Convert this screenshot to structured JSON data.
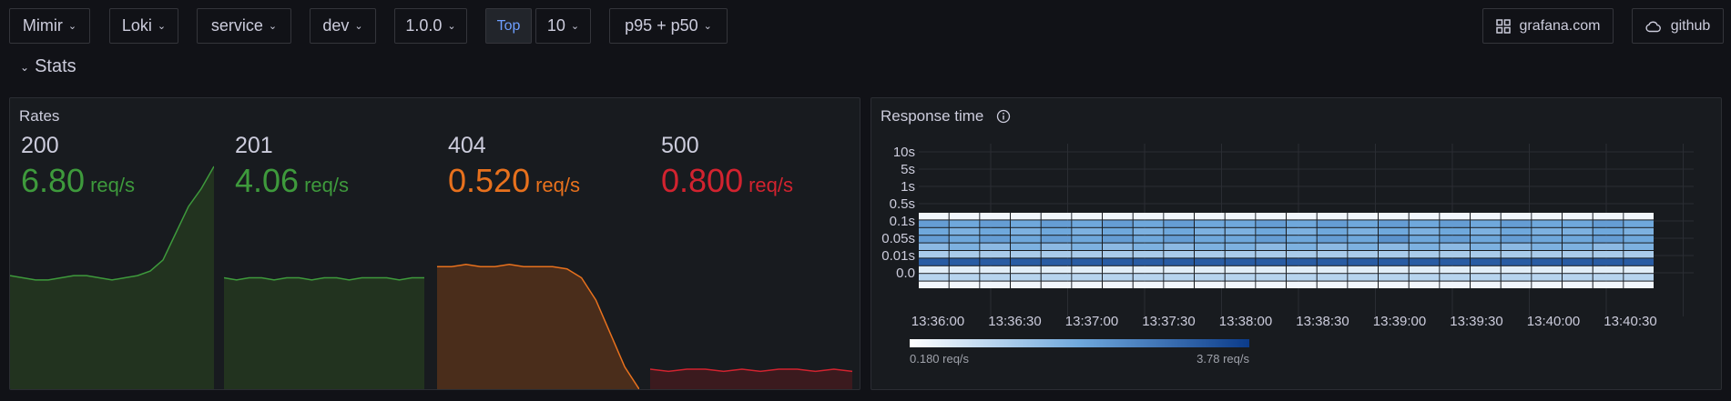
{
  "variables": [
    {
      "label": "Mimir"
    },
    {
      "label": "Loki"
    },
    {
      "label": "service"
    },
    {
      "label": "dev"
    },
    {
      "label": "1.0.0"
    }
  ],
  "top": {
    "label": "Top",
    "value": "10"
  },
  "percentile": {
    "label": "p95 + p50"
  },
  "links": {
    "grafana": "grafana.com",
    "github": "github"
  },
  "row": {
    "title": "Stats"
  },
  "rates": {
    "title": "Rates",
    "stats": [
      {
        "label": "200",
        "value": "6.80",
        "unit": "req/s",
        "color": "#3e9a3c",
        "fill": "#22331f",
        "spark": [
          0.49,
          0.5,
          0.51,
          0.51,
          0.5,
          0.49,
          0.49,
          0.5,
          0.51,
          0.5,
          0.49,
          0.47,
          0.42,
          0.3,
          0.18,
          0.1,
          0.0
        ]
      },
      {
        "label": "201",
        "value": "4.06",
        "unit": "req/s",
        "color": "#3e9a3c",
        "fill": "#22331f",
        "spark": [
          0.5,
          0.51,
          0.5,
          0.5,
          0.51,
          0.5,
          0.5,
          0.51,
          0.5,
          0.5,
          0.51,
          0.5,
          0.5,
          0.5,
          0.51,
          0.5,
          0.5
        ]
      },
      {
        "label": "404",
        "value": "0.520",
        "unit": "req/s",
        "color": "#e8711d",
        "fill": "#4a2d1b",
        "spark": [
          0.45,
          0.45,
          0.44,
          0.45,
          0.45,
          0.44,
          0.45,
          0.45,
          0.45,
          0.46,
          0.5,
          0.6,
          0.75,
          0.9,
          1.0
        ]
      },
      {
        "label": "500",
        "value": "0.800",
        "unit": "req/s",
        "color": "#d2232f",
        "fill": "#3b1a1e",
        "spark": [
          0.91,
          0.92,
          0.91,
          0.91,
          0.92,
          0.91,
          0.92,
          0.91,
          0.91,
          0.92,
          0.91,
          0.92
        ]
      }
    ]
  },
  "response_time": {
    "title": "Response time",
    "info_icon": "info-circle-icon",
    "legend": {
      "min": "0.180 req/s",
      "max": "3.78 req/s"
    }
  },
  "chart_data": {
    "type": "heatmap",
    "title": "Response time",
    "y_buckets": [
      "0.0",
      "0.01s",
      "0.05s",
      "0.1s",
      "0.5s",
      "1s",
      "5s",
      "10s"
    ],
    "x_ticks": [
      "13:36:00",
      "13:36:30",
      "13:37:00",
      "13:37:30",
      "13:38:00",
      "13:38:30",
      "13:39:00",
      "13:39:30",
      "13:40:00",
      "13:40:30"
    ],
    "legend_range": [
      "0.180 req/s",
      "3.78 req/s"
    ],
    "rows": [
      [
        0.05,
        0.05,
        0.05,
        0.05,
        0.05,
        0.05,
        0.05,
        0.05,
        0.05,
        0.05,
        0.05,
        0.05,
        0.05,
        0.05,
        0.05,
        0.05,
        0.05,
        0.05,
        0.05,
        0.05,
        0.05,
        0.05,
        0.05,
        0.05
      ],
      [
        0.55,
        0.5,
        0.55,
        0.5,
        0.55,
        0.5,
        0.55,
        0.5,
        0.55,
        0.5,
        0.5,
        0.55,
        0.5,
        0.55,
        0.5,
        0.55,
        0.5,
        0.55,
        0.5,
        0.55,
        0.5,
        0.5,
        0.55,
        0.5
      ],
      [
        0.5,
        0.45,
        0.5,
        0.45,
        0.5,
        0.45,
        0.5,
        0.45,
        0.5,
        0.45,
        0.45,
        0.5,
        0.45,
        0.5,
        0.45,
        0.5,
        0.45,
        0.5,
        0.45,
        0.5,
        0.45,
        0.45,
        0.5,
        0.45
      ],
      [
        0.55,
        0.5,
        0.55,
        0.5,
        0.55,
        0.5,
        0.55,
        0.5,
        0.55,
        0.5,
        0.5,
        0.55,
        0.5,
        0.55,
        0.5,
        0.6,
        0.5,
        0.55,
        0.5,
        0.55,
        0.5,
        0.5,
        0.55,
        0.5
      ],
      [
        0.4,
        0.45,
        0.4,
        0.45,
        0.4,
        0.45,
        0.4,
        0.45,
        0.4,
        0.45,
        0.45,
        0.4,
        0.45,
        0.4,
        0.45,
        0.4,
        0.45,
        0.4,
        0.45,
        0.4,
        0.45,
        0.45,
        0.4,
        0.45
      ],
      [
        0.3,
        0.3,
        0.3,
        0.3,
        0.3,
        0.3,
        0.3,
        0.3,
        0.3,
        0.3,
        0.3,
        0.3,
        0.3,
        0.3,
        0.3,
        0.3,
        0.3,
        0.3,
        0.3,
        0.3,
        0.3,
        0.3,
        0.3,
        0.3
      ],
      [
        0.85,
        0.85,
        0.85,
        0.85,
        0.85,
        0.85,
        0.85,
        0.85,
        0.85,
        0.85,
        0.85,
        0.85,
        0.85,
        0.85,
        0.85,
        0.85,
        0.85,
        0.85,
        0.85,
        0.85,
        0.85,
        0.85,
        0.85,
        0.85
      ],
      [
        0.1,
        0.1,
        0.1,
        0.1,
        0.1,
        0.1,
        0.1,
        0.1,
        0.1,
        0.1,
        0.1,
        0.1,
        0.1,
        0.1,
        0.1,
        0.1,
        0.1,
        0.1,
        0.1,
        0.1,
        0.1,
        0.1,
        0.1,
        0.1
      ],
      [
        0.25,
        0.25,
        0.25,
        0.25,
        0.25,
        0.25,
        0.25,
        0.25,
        0.25,
        0.25,
        0.25,
        0.25,
        0.25,
        0.25,
        0.25,
        0.25,
        0.25,
        0.25,
        0.25,
        0.25,
        0.25,
        0.25,
        0.25,
        0.25
      ],
      [
        0.05,
        0.05,
        0.05,
        0.05,
        0.05,
        0.05,
        0.05,
        0.05,
        0.05,
        0.05,
        0.05,
        0.05,
        0.05,
        0.05,
        0.05,
        0.05,
        0.05,
        0.05,
        0.05,
        0.05,
        0.05,
        0.05,
        0.05,
        0.05
      ]
    ]
  },
  "colors": {
    "accent_blue": "#6e9fff",
    "heat_low": "#ffffff",
    "heat_high": "#0b3b8a"
  }
}
